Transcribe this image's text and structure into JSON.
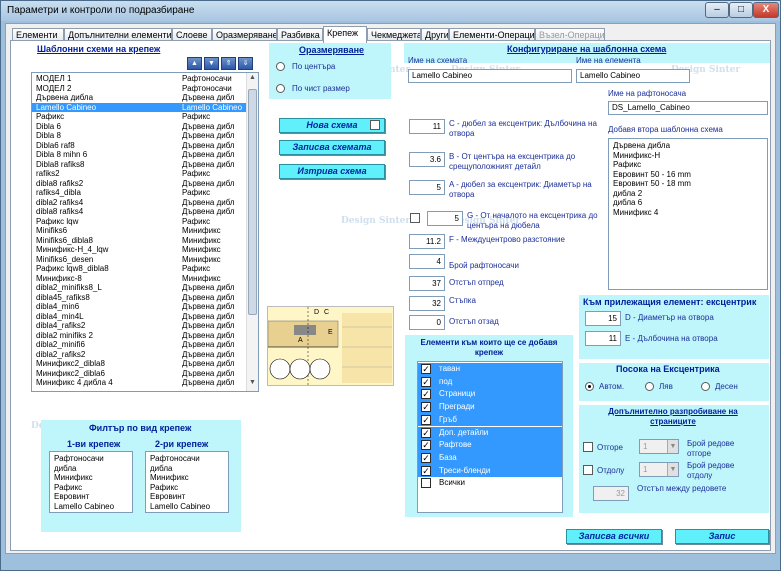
{
  "window": {
    "title": "Параметри и контроли по подразбиране",
    "min": "–",
    "max": "□",
    "close": "X"
  },
  "tabs": [
    {
      "label": "Елементи"
    },
    {
      "label": "Допълнителни елементи"
    },
    {
      "label": "Слоеве"
    },
    {
      "label": "Оразмеряване"
    },
    {
      "label": "Разбивка"
    },
    {
      "label": "Крепеж"
    },
    {
      "label": "Чекмеджета"
    },
    {
      "label": "Други"
    },
    {
      "label": "Елементи-Операции"
    },
    {
      "label": "Възел-Операции"
    }
  ],
  "schemes": {
    "title": "Шаблонни схеми на крепеж",
    "rows": [
      {
        "name": "МОДЕЛ 1",
        "type": "Рафтоносачи"
      },
      {
        "name": "МОДЕЛ 2",
        "type": "Рафтоносачи"
      },
      {
        "name": "Дървена дибла",
        "type": "Дървена дибл"
      },
      {
        "name": "Lamello Cabineo",
        "type": "Lamello Cabineo"
      },
      {
        "name": "Рафикс",
        "type": "Рафикс"
      },
      {
        "name": "Dibla 6",
        "type": "Дървена дибл"
      },
      {
        "name": "Dibla 8",
        "type": "Дървена дибл"
      },
      {
        "name": "Dibla6 raf8",
        "type": "Дървена дибл"
      },
      {
        "name": "Dibla 8 mihn 6",
        "type": "Дървена дибл"
      },
      {
        "name": "Dibla8 rafiks8",
        "type": "Дървена дибл"
      },
      {
        "name": "rafiks2",
        "type": "Рафикс"
      },
      {
        "name": "dibla8 rafiks2",
        "type": "Дървена дибл"
      },
      {
        "name": "rafiks4_dibla",
        "type": "Рафикс"
      },
      {
        "name": "dibla2 rafiks4",
        "type": "Дървена дибл"
      },
      {
        "name": "dibla8 rafiks4",
        "type": "Дървена дибл"
      },
      {
        "name": "Рафикс lqw",
        "type": "Рафикс"
      },
      {
        "name": "Minifiks6",
        "type": "Минификс"
      },
      {
        "name": "Minifiks6_dibla8",
        "type": "Минификс"
      },
      {
        "name": "Минификс-Н_4_lqw",
        "type": "Минификс"
      },
      {
        "name": "Minifiks6_desen",
        "type": "Минификс"
      },
      {
        "name": "Рафикс lqw8_dibla8",
        "type": "Рафикс"
      },
      {
        "name": "Минификс-8",
        "type": "Минификс"
      },
      {
        "name": "dibla2_minifiks8_L",
        "type": "Дървена дибл"
      },
      {
        "name": "dibla45_rafiks8",
        "type": "Дървена дибл"
      },
      {
        "name": "dibla4_min6",
        "type": "Дървена дибл"
      },
      {
        "name": "dibla4_min4L",
        "type": "Дървена дибл"
      },
      {
        "name": "dibla4_rafiks2",
        "type": "Дървена дибл"
      },
      {
        "name": "dibla2 minifiks 2",
        "type": "Дървена дибл"
      },
      {
        "name": "dibla2_minifi6",
        "type": "Дървена дибл"
      },
      {
        "name": "dibla2_rafiks2",
        "type": "Дървена дибл"
      },
      {
        "name": "Минификс2_dibla8",
        "type": "Дървена дибл"
      },
      {
        "name": "Минификс2_dibla6",
        "type": "Дървена дибл"
      },
      {
        "name": "Минификс 4 дибла 4",
        "type": "Дървена дибл"
      }
    ],
    "selected_index": 3
  },
  "filter": {
    "title": "Филтър по вид крепеж",
    "col1_title": "1-ви крепеж",
    "col2_title": "2-ри крепеж",
    "col1": [
      "Рафтоносачи",
      "дибла",
      "Минификс",
      "Рафикс",
      "Евровинт",
      "Lamello Cabineo"
    ],
    "col2": [
      "Рафтоносачи",
      "дибла",
      "Минификс",
      "Рафикс",
      "Евровинт",
      "Lamello Cabineo"
    ]
  },
  "sizing": {
    "title": "Оразмеряване",
    "opt1": "По центъра",
    "opt2": "По чист размер"
  },
  "buttons": {
    "new": "Нова схема",
    "save": "Записва схемата",
    "delete": "Изтрива схема",
    "save_all": "Записва всички",
    "write": "Запис"
  },
  "config": {
    "title": "Конфигуриране на шаблонна схема",
    "scheme_name_label": "Име на схемата",
    "scheme_name": "Lamello Cabineo",
    "element_name_label": "Име на елемента",
    "element_name": "Lamello Cabineo",
    "shelf_name_label": "Име на рафтоносача",
    "shelf_name": "DS_Lamello_Cabineo",
    "second_label": "Добавя втора шаблонна схема",
    "second_list": [
      "Дървена дибла",
      "Минификс-Н",
      "Рафикс",
      "Евровинт 50 - 16 mm",
      "Евровинт 50 - 18 mm",
      "дибла 2",
      "дибла 6",
      "Минификс 4"
    ]
  },
  "params": [
    {
      "value": "11",
      "label": "C - дюбел за ексцентрик: Дълбочина на отвора"
    },
    {
      "value": "3.6",
      "label": "B - От центъра на ексцентрика до срещуположният детайл"
    },
    {
      "value": "5",
      "label": "A - дюбел за ексцентрик: Диаметър на отвора"
    },
    {
      "value": "5",
      "label": "G - От началото на ексцентрика до центъра на дюбела"
    },
    {
      "value": "11.2",
      "label": "F - Междуцентрово разстояние"
    },
    {
      "value": "4",
      "label": "Брой рафтоносачи"
    },
    {
      "value": "37",
      "label": "Отстъп отпред"
    },
    {
      "value": "32",
      "label": "Стъпка"
    },
    {
      "value": "0",
      "label": "Отстъп отзад"
    }
  ],
  "elements": {
    "title": "Елементи към които ще се добавя крепеж",
    "items": [
      "таван",
      "под",
      "Страници",
      "Прегради",
      "Гръб",
      "Доп. детайли",
      "Рафтове",
      "База",
      "Треси-бленди",
      "Всички"
    ]
  },
  "eccentric": {
    "title": "Към прилежащия елемент: ексцентрик",
    "d_value": "15",
    "d_label": "D - Диаметър на отвора",
    "e_value": "11",
    "e_label": "E - Дълбочина на отвора"
  },
  "direction": {
    "title": "Посока на Ексцентрика",
    "opt1": "Автом.",
    "opt2": "Ляв",
    "opt3": "Десен"
  },
  "extra": {
    "title": "Допълнително разпробиване на страниците",
    "top_label": "Отгоре",
    "top_value": "1",
    "bottom_label": "Отдолу",
    "bottom_value": "1",
    "rows_top": "Брой редове отгоре",
    "rows_bottom": "Брой редове отдолу",
    "spacing_value": "32",
    "spacing_label": "Отстъп между редовете"
  },
  "diagram": {
    "label_d": "D",
    "label_c": "C",
    "label_e": "E",
    "label_a": "A"
  },
  "watermark": "Design Sinter"
}
